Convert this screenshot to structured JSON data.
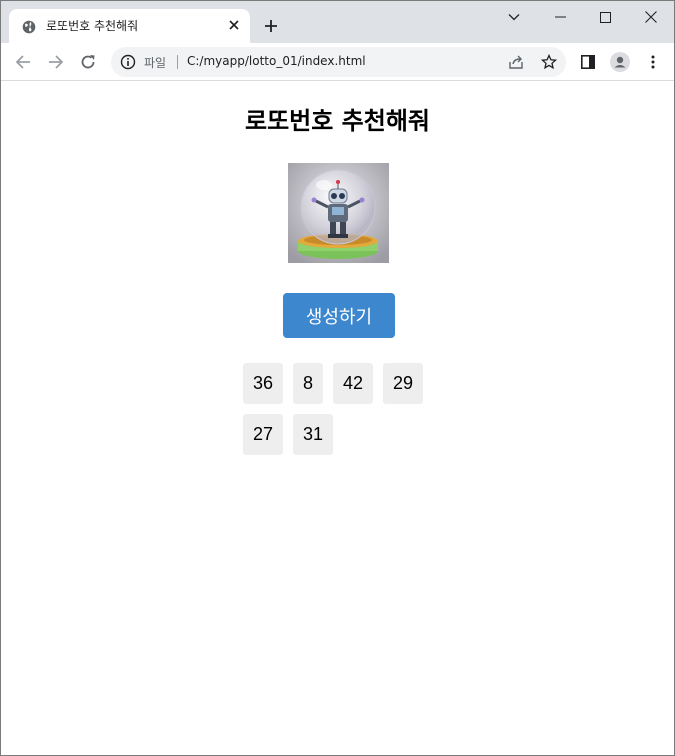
{
  "browser": {
    "tab_title": "로또번호 추천해줘",
    "scheme_label": "파일",
    "url": "C:/myapp/lotto_01/index.html"
  },
  "page": {
    "title": "로또번호 추천해줘",
    "button_label": "생성하기",
    "numbers": [
      "36",
      "8",
      "42",
      "29",
      "27",
      "31"
    ]
  },
  "colors": {
    "button": "#3d87cf",
    "number_bg": "#eeeeee",
    "tabbar_bg": "#dee1e6"
  },
  "icons": [
    "globe-icon",
    "close-icon",
    "plus-icon",
    "minimize-icon",
    "maximize-icon",
    "window-close-icon",
    "back-icon",
    "forward-icon",
    "reload-icon",
    "info-icon",
    "share-icon",
    "star-icon",
    "side-panel-icon",
    "profile-icon",
    "menu-icon"
  ]
}
